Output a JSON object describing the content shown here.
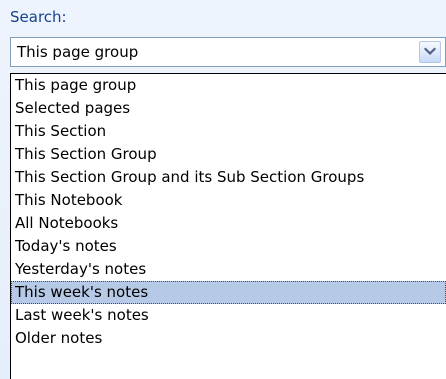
{
  "search": {
    "label": "Search:",
    "selected_value": "This page group",
    "options": [
      "This page group",
      "Selected pages",
      "This Section",
      "This Section Group",
      "This Section Group and its Sub Section Groups",
      "This Notebook",
      "All Notebooks",
      "Today's notes",
      "Yesterday's notes",
      "This week's notes",
      "Last week's notes",
      "Older notes"
    ],
    "highlighted_option": "This week's notes",
    "dropdown_icon": "chevron-down-icon"
  },
  "colors": {
    "label_text": "#15428b",
    "highlight_background": "#b6c9e6",
    "combo_border": "#7f9db9"
  }
}
